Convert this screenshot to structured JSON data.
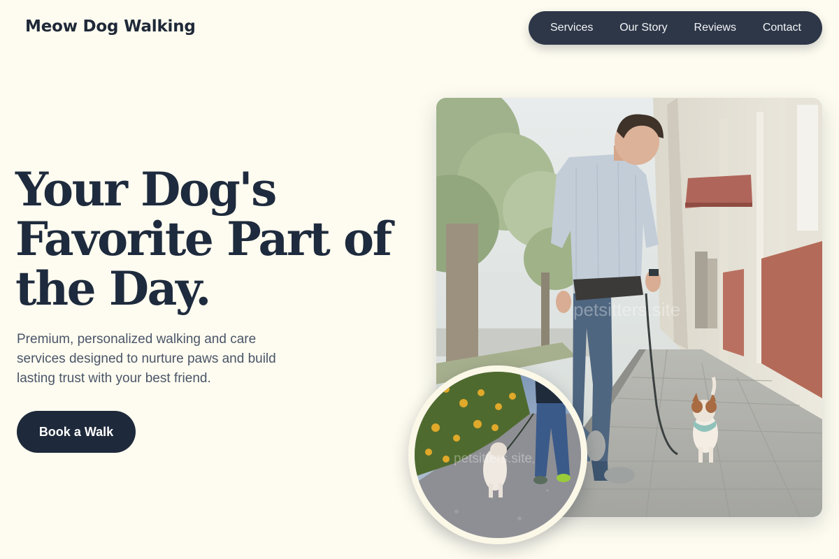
{
  "brand": {
    "name": "Meow Dog Walking"
  },
  "nav": {
    "items": [
      {
        "label": "Services"
      },
      {
        "label": "Our Story"
      },
      {
        "label": "Reviews"
      },
      {
        "label": "Contact"
      }
    ]
  },
  "hero": {
    "headline_lines": [
      "Your Dog's",
      "Favorite Part of",
      "the Day."
    ],
    "subtitle_lines": [
      "Premium, personalized walking and care",
      "services designed to nurture paws and build",
      "lasting trust with your best friend."
    ],
    "cta_label": "Book a Walk"
  },
  "images": {
    "main_watermark": "petsitters.site",
    "round_watermark": "petsitters.site"
  },
  "colors": {
    "background": "#fefcf0",
    "nav_background": "#2d3748",
    "heading": "#1e2a3d",
    "body_text": "#4a5568",
    "button": "#1e293b"
  }
}
